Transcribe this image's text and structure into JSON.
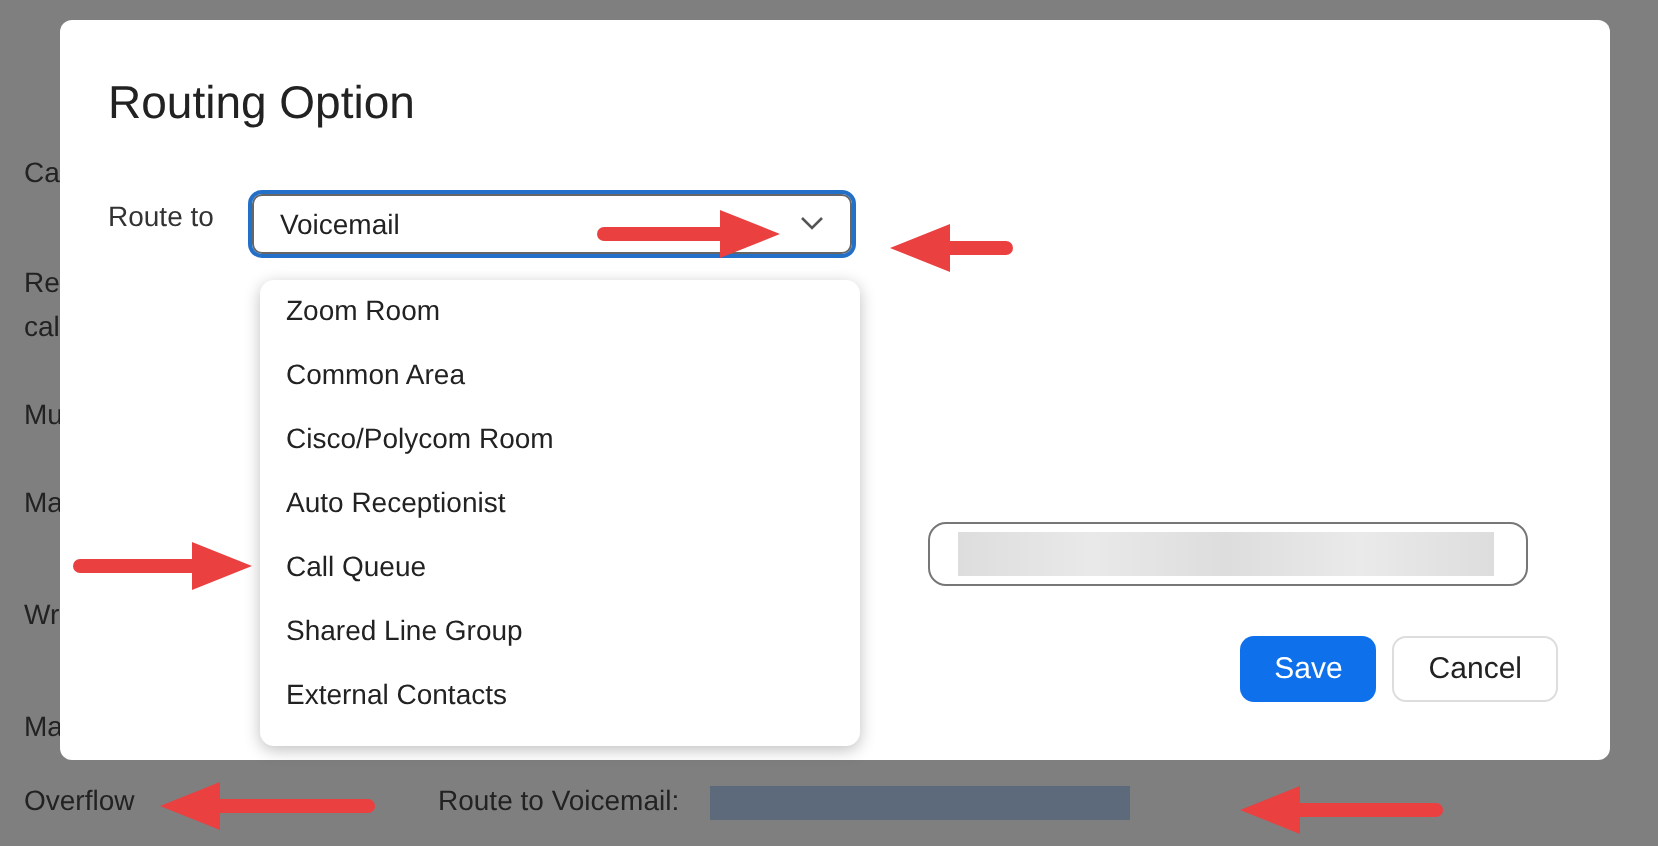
{
  "background": {
    "row_labels": [
      "Ca",
      "Re",
      "cal",
      "Mu",
      "Ma",
      "Wr",
      "Ma"
    ],
    "overflow": {
      "label": "Overflow",
      "value": "Route to Voicemail:"
    }
  },
  "dialog": {
    "title": "Routing Option",
    "route_label": "Route to",
    "route_value": "Voicemail",
    "dropdown_open": true,
    "options": [
      "Zoom Room",
      "Common Area",
      "Cisco/Polycom Room",
      "Auto Receptionist",
      "Call Queue",
      "Shared Line Group",
      "External Contacts"
    ],
    "buttons": [
      {
        "label": "Save",
        "kind": "primary"
      },
      {
        "label": "Cancel",
        "kind": "secondary"
      }
    ]
  },
  "annotations": [
    {
      "kind": "right_arrow"
    },
    {
      "kind": "left_arrow"
    },
    {
      "kind": "right_arrow"
    },
    {
      "kind": "left_arrow"
    },
    {
      "kind": "left_arrow"
    }
  ]
}
